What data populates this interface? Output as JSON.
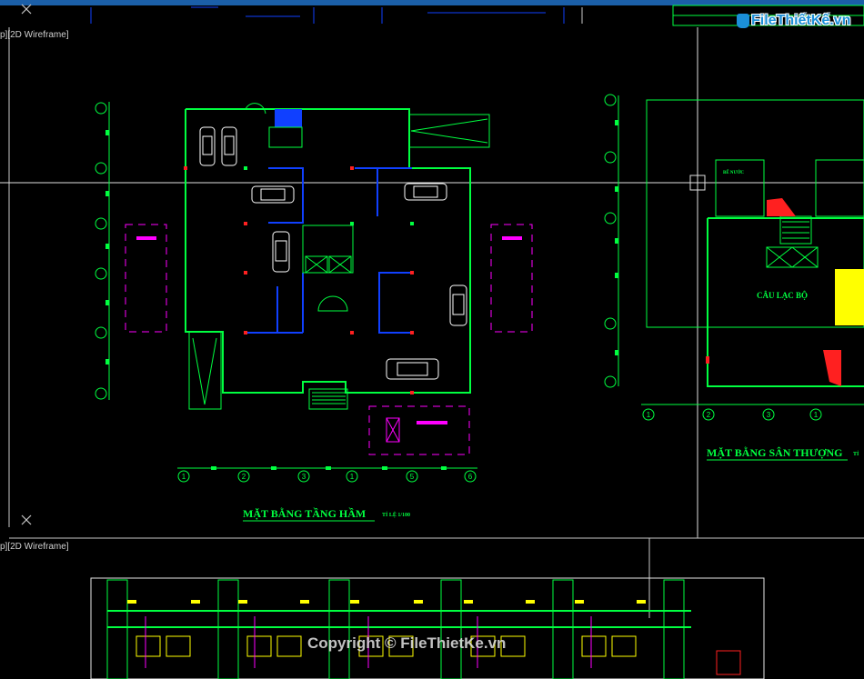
{
  "viewport_top": {
    "label": "p][2D Wireframe]"
  },
  "viewport_bottom": {
    "label": "p][2D Wireframe]"
  },
  "logo": {
    "brand": "FileThiếtKế.vn"
  },
  "watermark": {
    "text": "Copyright © FileThietKe.vn"
  },
  "basement_plan": {
    "title": "MẶT BẰNG TẦNG HẦM",
    "scale": "TỈ LỆ 1/100",
    "axis_numbers": [
      "1",
      "2",
      "3",
      "1",
      "5",
      "6"
    ]
  },
  "roof_plan": {
    "title": "MẶT BẰNG SÂN THƯỢNG",
    "scale": "TỈ",
    "room_label": "CÂU LẠC BỘ",
    "tank_label": "BỂ NƯỚC",
    "axis_numbers": [
      "1",
      "2",
      "3",
      "1"
    ]
  },
  "colors": {
    "cad_green": "#00ff40",
    "cad_blue": "#1040ff",
    "cad_magenta": "#ff00ff",
    "cad_red": "#ff2020",
    "cad_yellow": "#ffff00",
    "crosshair": "#e0e0e0",
    "titlebar": "#1b5fa8"
  }
}
